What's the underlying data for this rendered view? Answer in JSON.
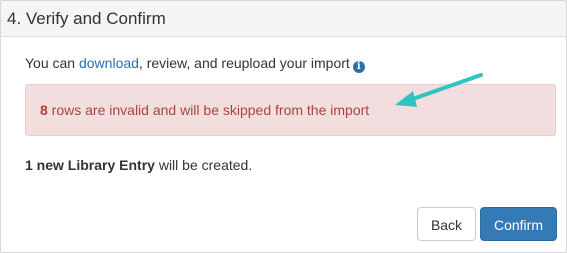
{
  "panel": {
    "title": "4. Verify and Confirm"
  },
  "intro": {
    "prefix": "You can ",
    "link_label": "download",
    "suffix": ", review, and reupload your import",
    "info_icon": "info-circle-icon"
  },
  "alert": {
    "count": "8",
    "message": " rows are invalid and will be skipped from the import",
    "arrow_color": "#2ec4c0"
  },
  "summary": {
    "bold": "1 new Library Entry",
    "rest": " will be created."
  },
  "actions": {
    "back_label": "Back",
    "confirm_label": "Confirm"
  },
  "colors": {
    "link": "#2a6fb1",
    "alert_bg": "#f2dede",
    "alert_text": "#a94442",
    "primary": "#337ab7"
  }
}
